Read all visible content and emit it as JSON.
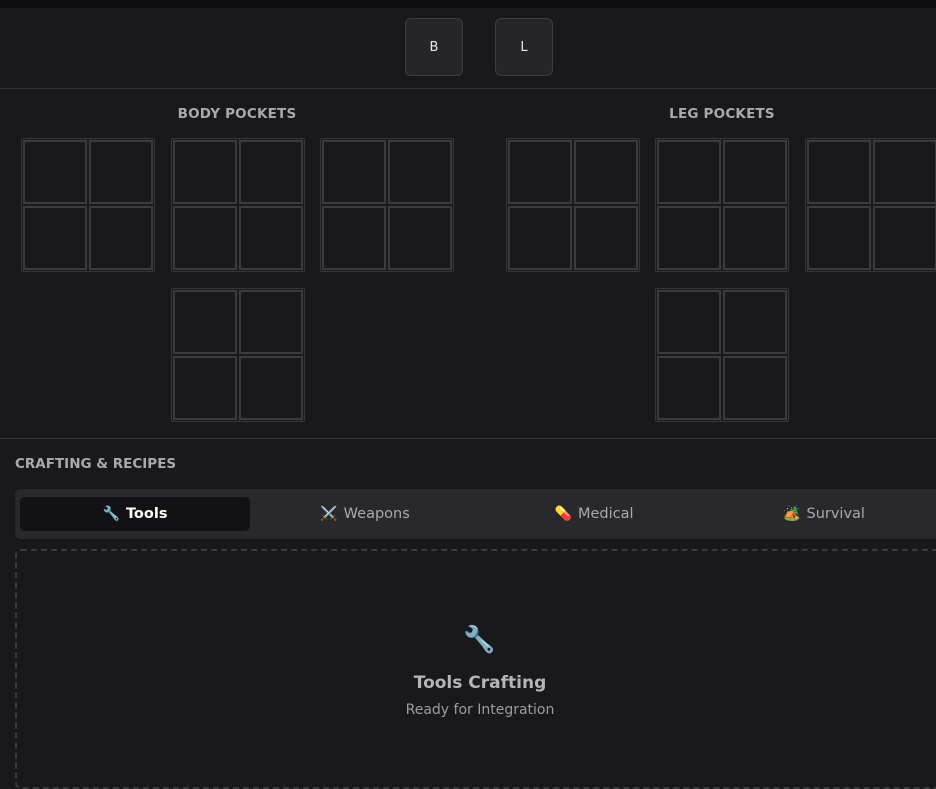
{
  "equip_buttons": [
    {
      "label": "B"
    },
    {
      "label": "L"
    }
  ],
  "body_pockets": {
    "title": "BODY POCKETS"
  },
  "leg_pockets": {
    "title": "LEG POCKETS"
  },
  "crafting": {
    "title": "CRAFTING & RECIPES",
    "tabs": [
      {
        "icon": "🔧",
        "label": "Tools",
        "active": true
      },
      {
        "icon": "⚔️",
        "label": "Weapons"
      },
      {
        "icon": "💊",
        "label": "Medical"
      },
      {
        "icon": "🏕️",
        "label": "Survival"
      }
    ],
    "panel": {
      "icon": "🔧",
      "title": "Tools Crafting",
      "subtitle": "Ready for Integration"
    }
  }
}
